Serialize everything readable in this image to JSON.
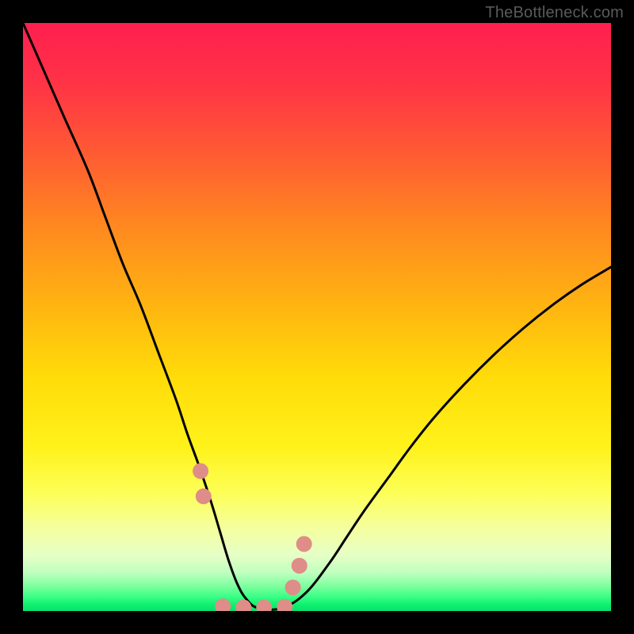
{
  "watermark": "TheBottleneck.com",
  "chart_data": {
    "type": "line",
    "title": "",
    "xlabel": "",
    "ylabel": "",
    "xlim": [
      0,
      100
    ],
    "ylim": [
      0,
      100
    ],
    "background_gradient_stops": [
      {
        "offset": 0.0,
        "color": "#ff1f4f"
      },
      {
        "offset": 0.1,
        "color": "#ff3246"
      },
      {
        "offset": 0.22,
        "color": "#ff5a33"
      },
      {
        "offset": 0.35,
        "color": "#ff8a1f"
      },
      {
        "offset": 0.48,
        "color": "#ffb411"
      },
      {
        "offset": 0.6,
        "color": "#ffdb09"
      },
      {
        "offset": 0.72,
        "color": "#fff21a"
      },
      {
        "offset": 0.8,
        "color": "#fdff58"
      },
      {
        "offset": 0.86,
        "color": "#f4ff9f"
      },
      {
        "offset": 0.905,
        "color": "#e6ffc6"
      },
      {
        "offset": 0.935,
        "color": "#bfffbf"
      },
      {
        "offset": 0.958,
        "color": "#7dff9d"
      },
      {
        "offset": 0.975,
        "color": "#3dff87"
      },
      {
        "offset": 0.99,
        "color": "#0cf06e"
      },
      {
        "offset": 1.0,
        "color": "#0ae070"
      }
    ],
    "series": [
      {
        "name": "bottleneck-curve",
        "stroke": "#000000",
        "stroke_width": 3,
        "x": [
          0,
          3.5,
          7,
          11,
          14,
          17,
          20,
          23,
          26,
          28,
          30,
          32,
          33.5,
          35,
          36.5,
          38,
          40,
          44,
          48,
          52,
          55,
          58,
          62,
          66,
          70,
          75,
          80,
          85,
          90,
          95,
          100
        ],
        "y": [
          100,
          92,
          84,
          75,
          67,
          59,
          52,
          44,
          36,
          30,
          24.5,
          18.5,
          13.5,
          8.5,
          4.5,
          2,
          0.5,
          0.5,
          3,
          8,
          12.5,
          17,
          22.5,
          28,
          33,
          38.5,
          43.5,
          48,
          52,
          55.5,
          58.5
        ]
      },
      {
        "name": "marker-dots",
        "type": "scatter",
        "color": "#df8d88",
        "radius": 10,
        "x": [
          30.2,
          30.7,
          34,
          37.5,
          41,
          44.5,
          45.9,
          47.0,
          47.8
        ],
        "y": [
          23.8,
          19.5,
          0.8,
          0.6,
          0.6,
          0.7,
          4.0,
          7.7,
          11.4
        ]
      }
    ]
  }
}
